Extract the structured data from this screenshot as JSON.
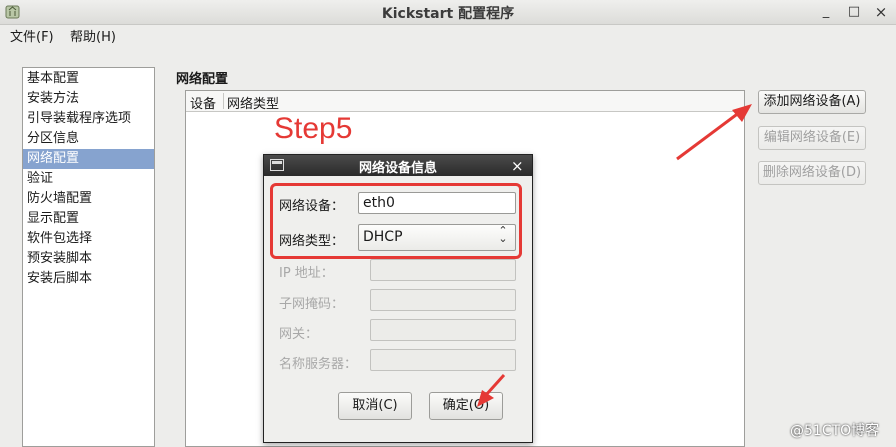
{
  "window": {
    "title": "Kickstart 配置程序",
    "controls": {
      "minimize": "_",
      "maximize": "□",
      "close": "×"
    }
  },
  "menubar": {
    "file": "文件(F)",
    "help": "帮助(H)"
  },
  "sidebar": {
    "items": [
      {
        "label": "基本配置",
        "selected": false
      },
      {
        "label": "安装方法",
        "selected": false
      },
      {
        "label": "引导装载程序选项",
        "selected": false
      },
      {
        "label": "分区信息",
        "selected": false
      },
      {
        "label": "网络配置",
        "selected": true
      },
      {
        "label": "验证",
        "selected": false
      },
      {
        "label": "防火墙配置",
        "selected": false
      },
      {
        "label": "显示配置",
        "selected": false
      },
      {
        "label": "软件包选择",
        "selected": false
      },
      {
        "label": "预安装脚本",
        "selected": false
      },
      {
        "label": "安装后脚本",
        "selected": false
      }
    ]
  },
  "main": {
    "section_title": "网络配置",
    "table": {
      "columns": [
        "设备",
        "网络类型"
      ]
    },
    "buttons": {
      "add": "添加网络设备(A)",
      "edit": "编辑网络设备(E)",
      "delete": "删除网络设备(D)"
    }
  },
  "annotation": {
    "step": "Step5",
    "color": "#e53935"
  },
  "dialog": {
    "title": "网络设备信息",
    "close": "×",
    "fields": {
      "device_label": "网络设备：",
      "device_value": "eth0",
      "type_label": "网络类型：",
      "type_value": "DHCP",
      "ip_label": "IP 地址：",
      "mask_label": "子网掩码：",
      "gateway_label": "网关：",
      "dns_label": "名称服务器："
    },
    "buttons": {
      "cancel": "取消(C)",
      "ok": "确定(O)"
    }
  },
  "watermark": "@51CTO博客"
}
